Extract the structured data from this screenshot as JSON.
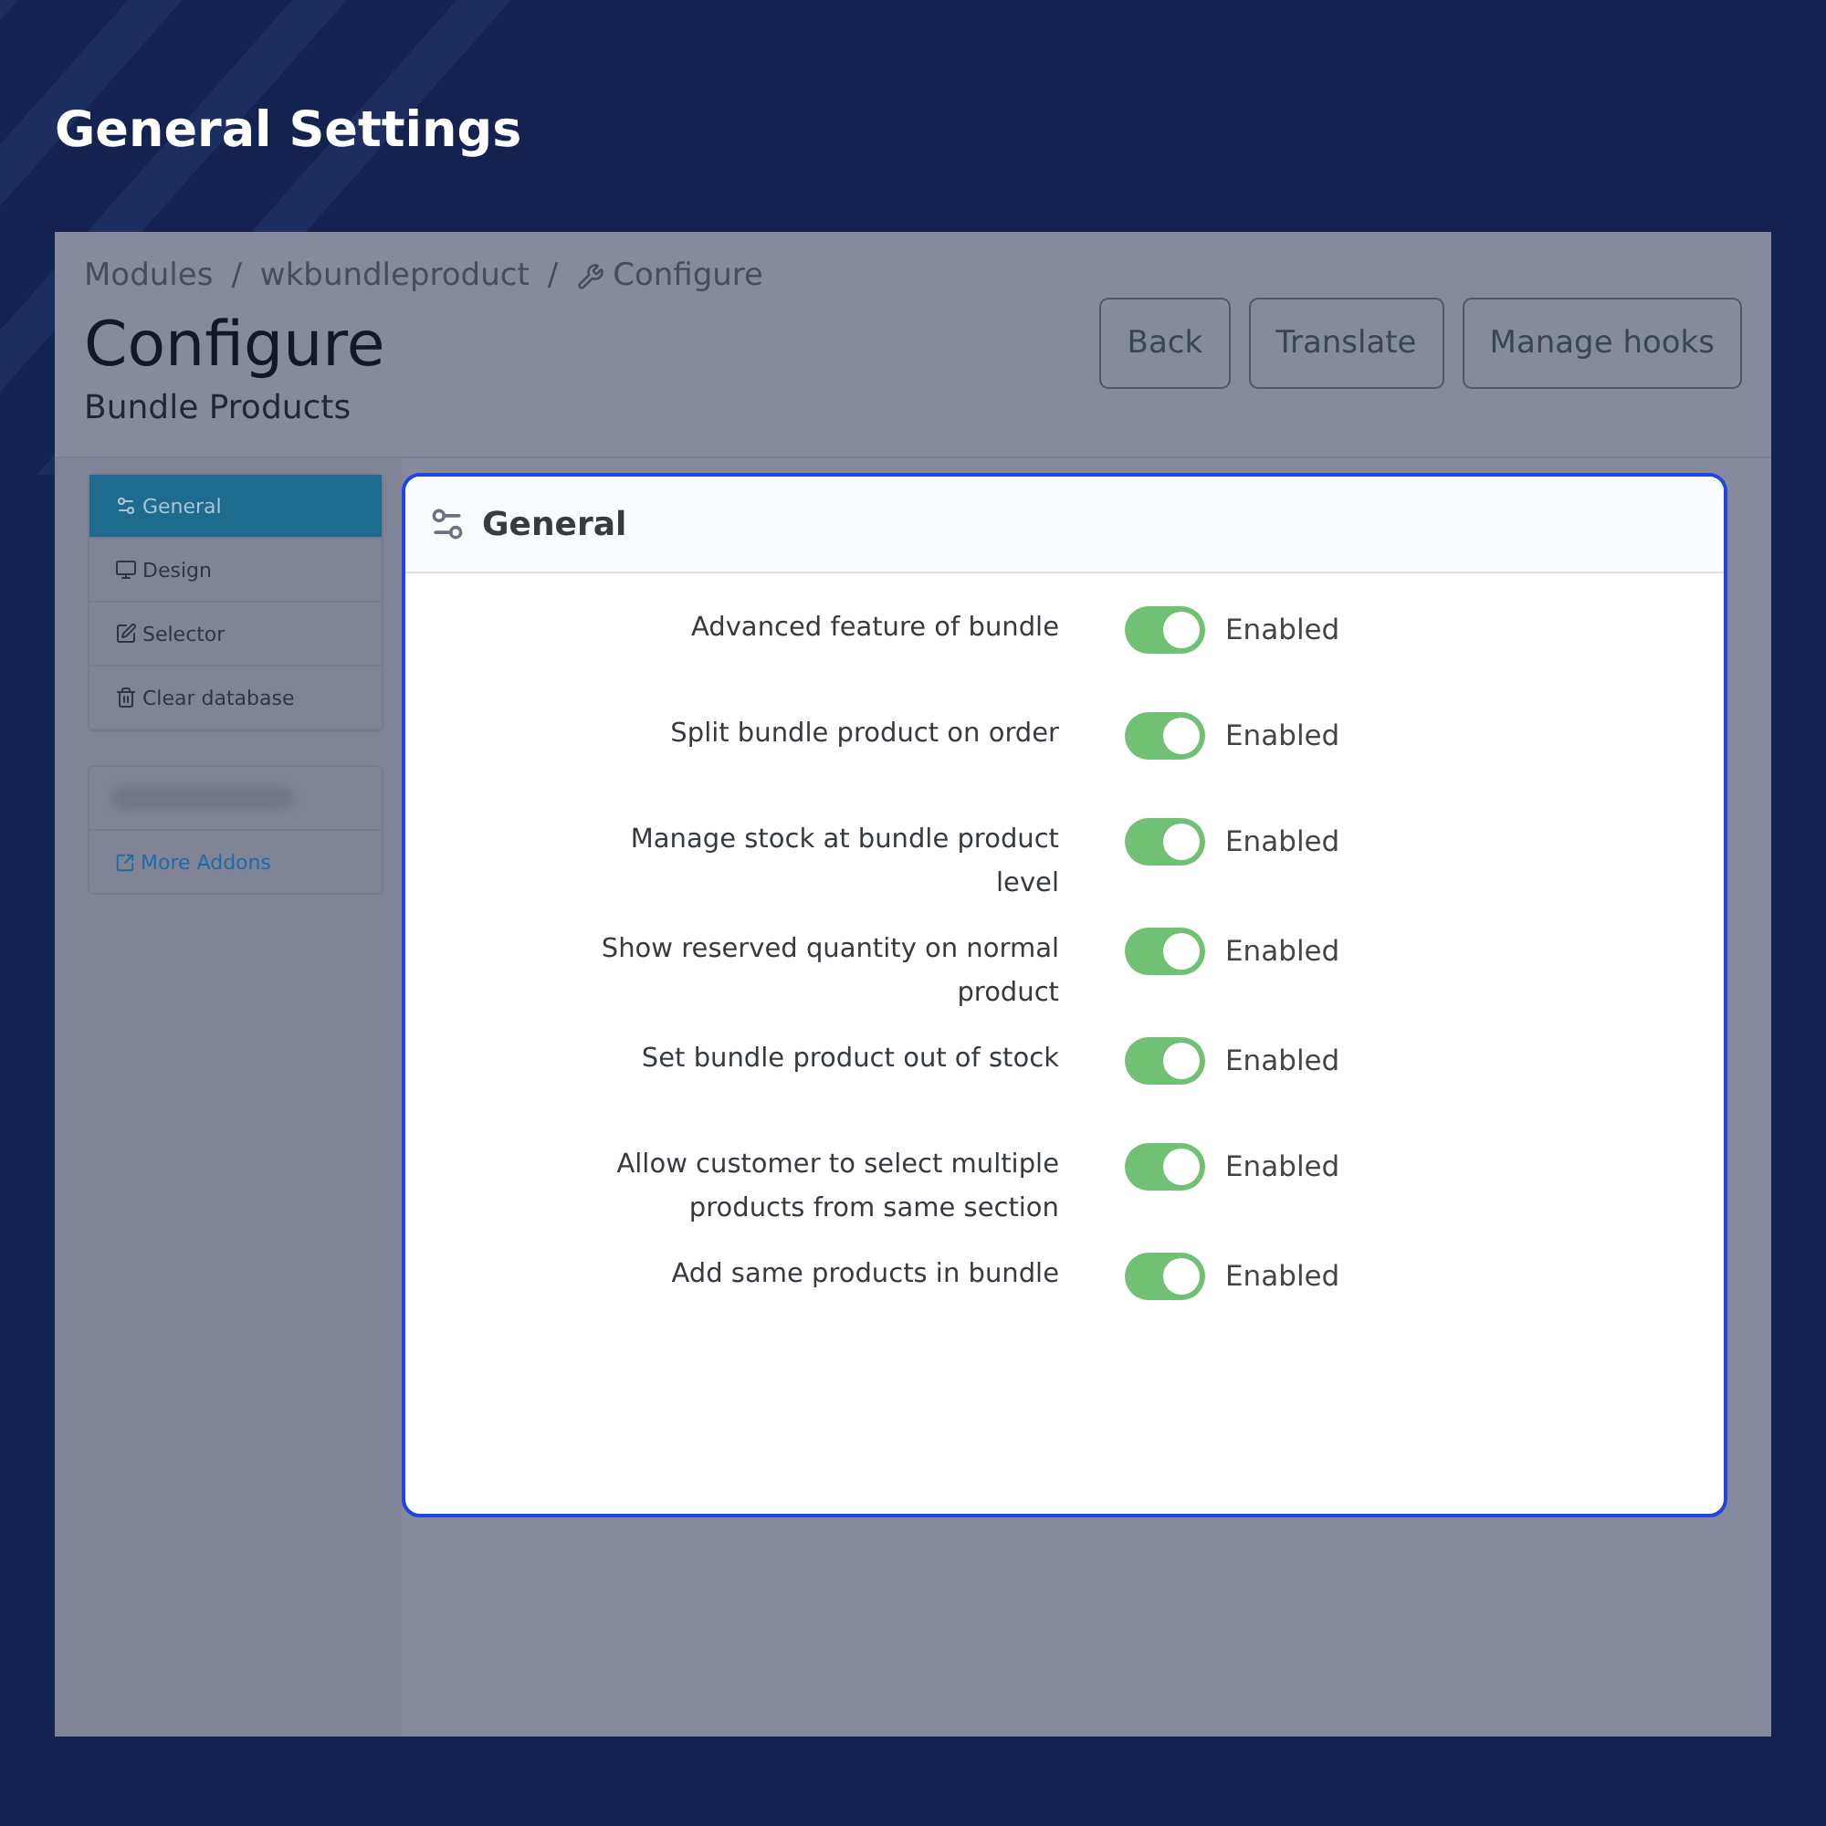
{
  "banner": {
    "title": "General Settings"
  },
  "breadcrumb": [
    {
      "label": "Modules",
      "separator": "/"
    },
    {
      "label": "wkbundleproduct",
      "separator": "/"
    },
    {
      "label": "Configure"
    }
  ],
  "header": {
    "title": "Configure",
    "subtitle": "Bundle Products"
  },
  "toolbar_buttons": [
    "Back",
    "Translate",
    "Manage hooks"
  ],
  "sidebar": {
    "items": [
      {
        "label": "General",
        "selected": true
      },
      {
        "label": "Design",
        "selected": false
      },
      {
        "label": "Selector",
        "selected": false
      },
      {
        "label": "Clear database",
        "selected": false
      }
    ],
    "addons_link": "More Addons"
  },
  "panel": {
    "title": "General",
    "settings": [
      {
        "label": "Advanced feature of bundle",
        "on": true,
        "status": "Enabled"
      },
      {
        "label": "Split bundle product on order",
        "on": true,
        "status": "Enabled"
      },
      {
        "label": "Manage stock at bundle product level",
        "on": true,
        "status": "Enabled"
      },
      {
        "label": "Show reserved quantity on normal product",
        "on": true,
        "status": "Enabled"
      },
      {
        "label": "Set bundle product out of stock",
        "on": true,
        "status": "Enabled"
      },
      {
        "label": "Allow customer to select multiple products from same section",
        "on": true,
        "status": "Enabled"
      },
      {
        "label": "Add same products in bundle",
        "on": true,
        "status": "Enabled"
      }
    ]
  }
}
